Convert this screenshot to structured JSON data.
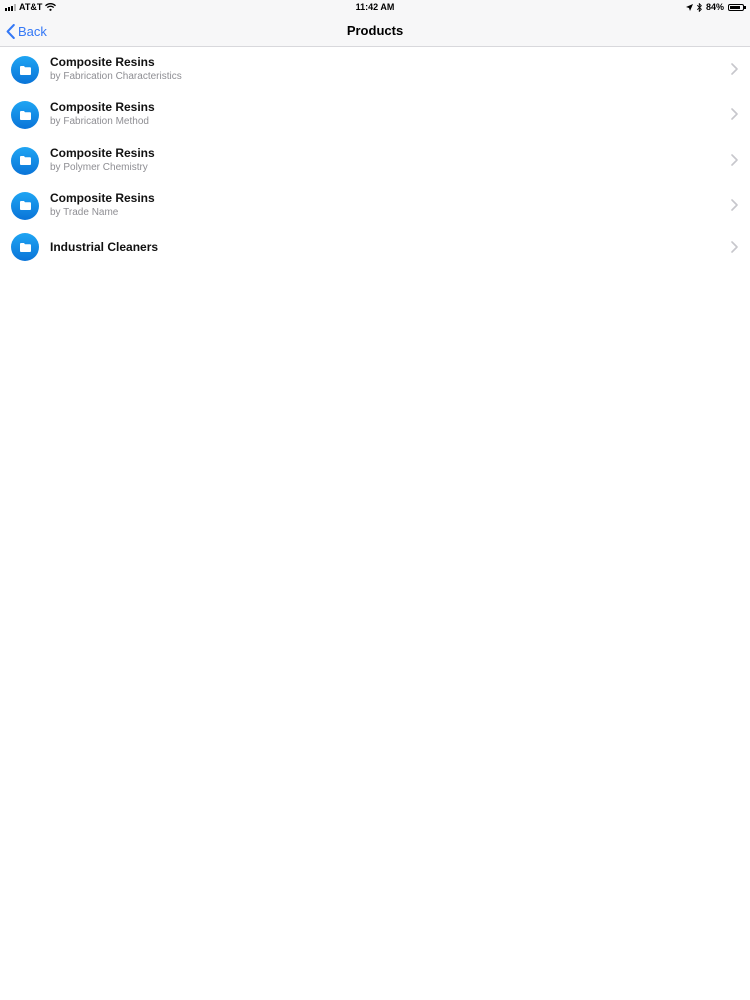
{
  "status_bar": {
    "carrier": "AT&T",
    "time": "11:42 AM",
    "battery_percent": "84%",
    "battery_level": 0.84,
    "icons": [
      "signal-icon",
      "wifi-icon",
      "location-arrow-icon",
      "bluetooth-icon",
      "battery-icon"
    ]
  },
  "nav": {
    "back_label": "Back",
    "title": "Products"
  },
  "list": {
    "items": [
      {
        "title": "Composite Resins",
        "subtitle": "by Fabrication Characteristics",
        "icon": "folder-icon"
      },
      {
        "title": "Composite Resins",
        "subtitle": "by Fabrication Method",
        "icon": "folder-icon"
      },
      {
        "title": "Composite Resins",
        "subtitle": "by Polymer Chemistry",
        "icon": "folder-icon"
      },
      {
        "title": "Composite Resins",
        "subtitle": "by Trade Name",
        "icon": "folder-icon"
      },
      {
        "title": "Industrial Cleaners",
        "subtitle": "",
        "icon": "folder-icon"
      }
    ]
  },
  "colors": {
    "accent": "#3478f6",
    "icon_gradient_top": "#1fa5f3",
    "icon_gradient_bottom": "#0a74d8",
    "subtitle": "#8e8e93",
    "chevron": "#c7c7cc"
  }
}
